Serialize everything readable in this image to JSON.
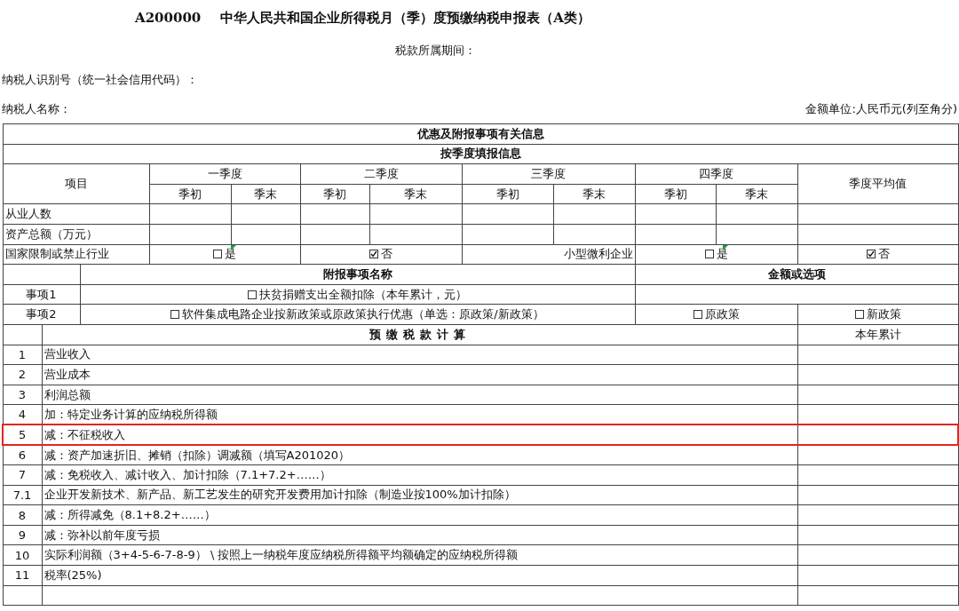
{
  "header": {
    "form_code": "A200000",
    "title": "中华人民共和国企业所得税月（季）度预缴纳税申报表（A类）",
    "period_label": "税款所属期间：",
    "taxpayer_id_label": "纳税人识别号（统一社会信用代码）：",
    "taxpayer_name_label": "纳税人名称：",
    "currency_note": "金额单位:人民币元(列至角分)"
  },
  "section_title": "优惠及附报事项有关信息",
  "quarterly": {
    "title": "按季度填报信息",
    "item_header": "项目",
    "average_header": "季度平均值",
    "quarters": [
      {
        "name": "一季度",
        "columns": [
          "季初",
          "季末"
        ]
      },
      {
        "name": "二季度",
        "columns": [
          "季初",
          "季末"
        ]
      },
      {
        "name": "三季度",
        "columns": [
          "季初",
          "季末"
        ]
      },
      {
        "name": "四季度",
        "columns": [
          "季初",
          "季末"
        ]
      }
    ],
    "rows": [
      {
        "label": "从业人数"
      },
      {
        "label": "资产总额（万元）"
      }
    ]
  },
  "flags": [
    {
      "label": "国家限制或禁止行业",
      "options": [
        {
          "label": "是",
          "checked": false,
          "comment": true
        },
        {
          "label": "否",
          "checked": true,
          "comment": false
        }
      ]
    },
    {
      "label": "小型微利企业",
      "options": [
        {
          "label": "是",
          "checked": false,
          "comment": true
        },
        {
          "label": "否",
          "checked": true,
          "comment": false
        }
      ]
    }
  ],
  "attachments": {
    "name_header": "附报事项名称",
    "value_header": "金额或选项",
    "items": [
      {
        "label": "事项1",
        "name": "扶贫捐赠支出全额扣除（本年累计，元）",
        "checked": false
      },
      {
        "label": "事项2",
        "name": "软件集成电路企业按新政策或原政策执行优惠（单选：原政策/新政策）",
        "checked": false,
        "options": [
          {
            "label": "原政策",
            "checked": false
          },
          {
            "label": "新政策",
            "checked": false
          }
        ]
      }
    ]
  },
  "calculation": {
    "title": "预缴税款计算",
    "value_header": "本年累计",
    "rows": [
      {
        "number": "1",
        "label": "营业收入",
        "highlighted": false
      },
      {
        "number": "2",
        "label": "营业成本",
        "highlighted": false
      },
      {
        "number": "3",
        "label": "利润总额",
        "highlighted": false
      },
      {
        "number": "4",
        "label": "加：特定业务计算的应纳税所得额",
        "highlighted": false
      },
      {
        "number": "5",
        "label": "减：不征税收入",
        "highlighted": true
      },
      {
        "number": "6",
        "label": "减：资产加速折旧、摊销（扣除）调减额（填写A201020）",
        "highlighted": false
      },
      {
        "number": "7",
        "label": "减：免税收入、减计收入、加计扣除（7.1+7.2+……）",
        "highlighted": false
      },
      {
        "number": "7.1",
        "label": "企业开发新技术、新产品、新工艺发生的研究开发费用加计扣除（制造业按100%加计扣除）",
        "highlighted": false
      },
      {
        "number": "8",
        "label": "减：所得减免（8.1+8.2+……）",
        "highlighted": false
      },
      {
        "number": "9",
        "label": "减：弥补以前年度亏损",
        "highlighted": false
      },
      {
        "number": "10",
        "label": "实际利润额（3+4-5-6-7-8-9） \\ 按照上一纳税年度应纳税所得额平均额确定的应纳税所得额",
        "highlighted": false
      },
      {
        "number": "11",
        "label": "税率(25%)",
        "highlighted": false
      }
    ]
  }
}
